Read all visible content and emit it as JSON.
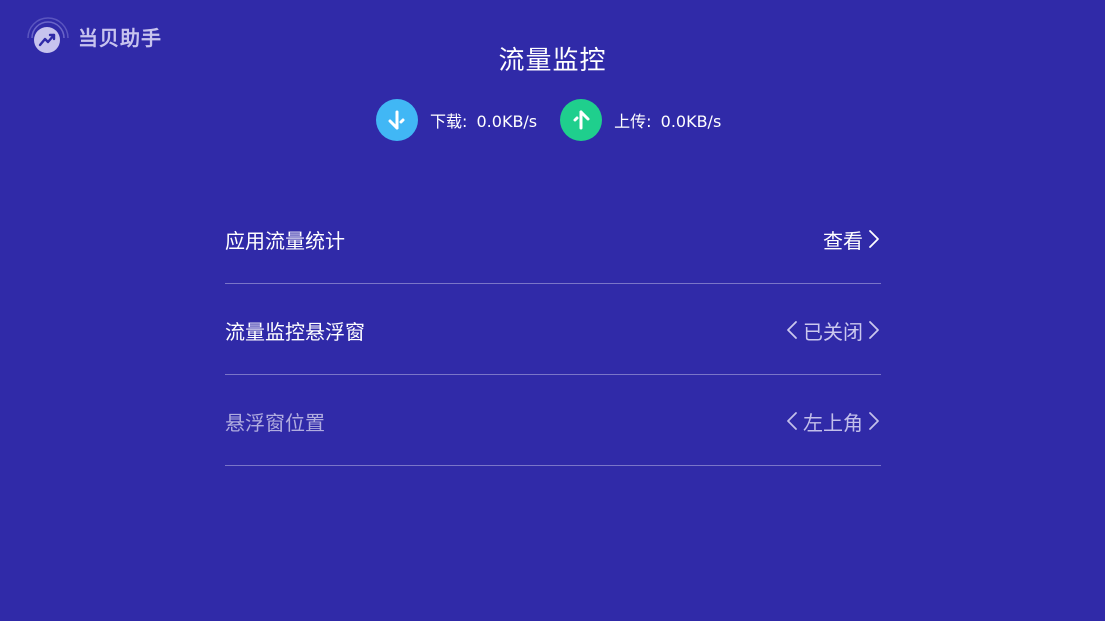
{
  "app": {
    "logo_text": "当贝助手"
  },
  "page": {
    "title": "流量监控"
  },
  "speed": {
    "download": {
      "label": "下载:",
      "value": "0.0KB/s",
      "color": "#41b7f5"
    },
    "upload": {
      "label": "上传:",
      "value": "0.0KB/s",
      "color": "#1fcf8d"
    }
  },
  "settings": {
    "items": [
      {
        "label": "应用流量统计",
        "value": "查看"
      },
      {
        "label": "流量监控悬浮窗",
        "value": "已关闭"
      },
      {
        "label": "悬浮窗位置",
        "value": "左上角"
      }
    ]
  },
  "colors": {
    "background": "#302aa8",
    "divider": "#7a75c8"
  }
}
